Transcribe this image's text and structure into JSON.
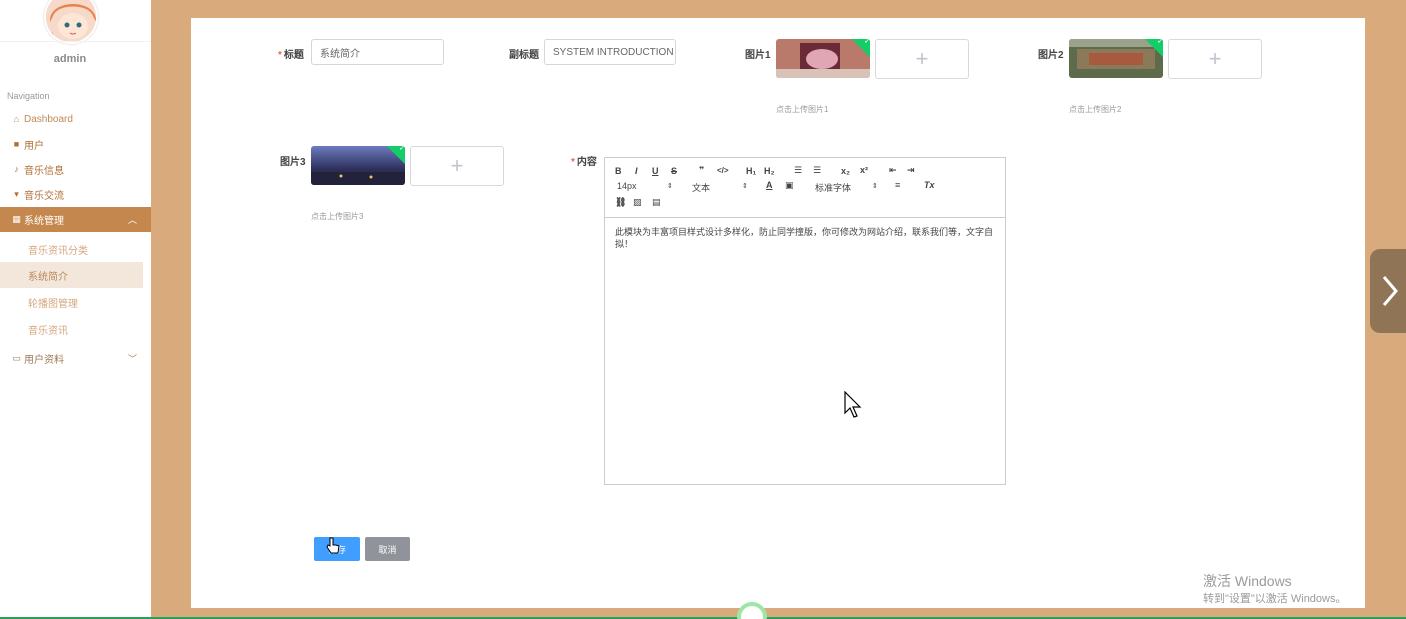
{
  "sidebar": {
    "username": "admin",
    "nav_heading": "Navigation",
    "items": [
      {
        "label": "Dashboard",
        "icon": "home-icon"
      },
      {
        "label": "用户",
        "icon": "users-icon"
      },
      {
        "label": "音乐信息",
        "icon": "music-icon"
      },
      {
        "label": "音乐交流",
        "icon": "chat-icon"
      },
      {
        "label": "系统管理",
        "icon": "grid-icon",
        "expanded": true
      },
      {
        "label": "用户资料",
        "icon": "folder-icon",
        "expanded": false
      }
    ],
    "sub_items": [
      "音乐资讯分类",
      "系统简介",
      "轮播图管理",
      "音乐资讯"
    ],
    "selected_sub_item": "系统简介"
  },
  "form": {
    "title_label": "标题",
    "title_value": "系统简介",
    "subtitle_label": "副标题",
    "subtitle_value": "SYSTEM INTRODUCTION",
    "image1_label": "图片1",
    "image1_hint": "点击上传图片1",
    "image2_label": "图片2",
    "image2_hint": "点击上传图片2",
    "image3_label": "图片3",
    "image3_hint": "点击上传图片3",
    "upload_plus": "+",
    "content_label": "内容",
    "content_text": "此模块为丰富项目样式设计多样化，防止同学撞版，你可修改为网站介绍，联系我们等，文字自拟！",
    "toolbar": {
      "bold": "B",
      "italic": "I",
      "underline": "U",
      "strike": "S",
      "quote": "❞",
      "code": "</>",
      "h1": "H₁",
      "h2": "H₂",
      "size": "14px",
      "header": "文本",
      "font": "标准字体",
      "sub": "x₂",
      "sup": "x²",
      "clean": "Tx"
    },
    "save_label": "保存",
    "cancel_label": "取消"
  },
  "watermark": {
    "line1": "激活 Windows",
    "line2": "转到\"设置\"以激活 Windows。"
  },
  "colors": {
    "background": "#d9ab7c",
    "sidebar_active": "#c4874d",
    "primary": "#409eff",
    "success": "#13ce66"
  }
}
